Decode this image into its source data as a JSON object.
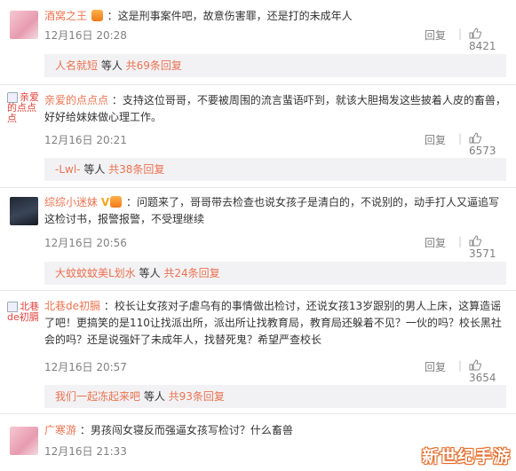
{
  "comments": [
    {
      "user": "酒窝之王",
      "text": "：这是刑事案件吧，故意伤害罪，还是打的未成年人",
      "time": "12月16日 20:28",
      "reply": "回复",
      "likes": "8421",
      "sub": {
        "who": "人名就短",
        "mid": " 等人 ",
        "count": "共69条回复"
      }
    },
    {
      "user": "亲爱的点点点",
      "avatar_text": "亲爱的点点点",
      "text": "：支持这位哥哥，不要被周围的流言蜚语吓到，就该大胆揭发这些披着人皮的畜兽，好好给妹妹做心理工作。",
      "time": "12月16日 20:21",
      "reply": "回复",
      "likes": "6573",
      "sub": {
        "who": "-Lwl-",
        "mid": " 等人 ",
        "count": "共38条回复"
      }
    },
    {
      "user": "综综小迷妹",
      "text": "：问题来了，哥哥带去检查也说女孩子是清白的，不说别的，动手打人又逼追写这检讨书，报警报警，不受理继续",
      "time": "12月16日 20:56",
      "reply": "回复",
      "likes": "3571",
      "sub": {
        "who": "大蚊蚊蚊美L划水",
        "mid": " 等人 ",
        "count": "共24条回复"
      }
    },
    {
      "user": "北巷de初膈",
      "avatar_text": "北巷de初膈",
      "text": "：校长让女孩对子虐乌有的事情做出检讨，还说女孩13岁跟别的男人上床，这算造谣了吧！更搞笑的是110让找派出所，派出所让找教育局，教育局还躲着不见？一伙的吗？校长黑社会的吗？还是说强奸了未成年人，找替死鬼？希望严查校长",
      "time": "12月16日 20:57",
      "reply": "回复",
      "likes": "3654",
      "sub": {
        "who": "我们一起冻起来吧",
        "mid": " 等人 ",
        "count": "共93条回复"
      }
    },
    {
      "user": "广寒游",
      "text": "：男孩闯女寝反而强逼女孩写检讨？什么畜兽",
      "time": "12月16日 21:33",
      "reply": "回复",
      "likes": ""
    }
  ],
  "watermark": "新世纪手游",
  "icons": {
    "like": "thumbs-up-icon",
    "vip": "vip-crown-icon"
  },
  "colors": {
    "username": "#eb7350",
    "meta": "#808080",
    "sub_bg": "#f2f2f5"
  }
}
